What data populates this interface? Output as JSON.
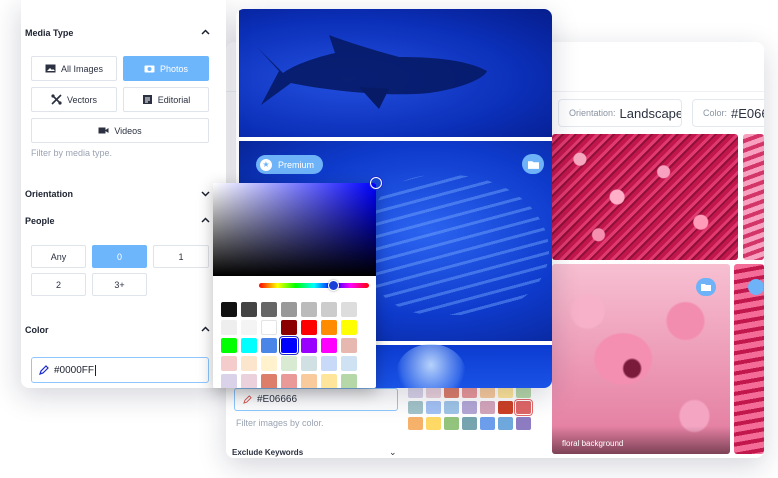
{
  "filters": {
    "media_type": {
      "title": "Media Type",
      "buttons": [
        {
          "label": "All Images",
          "active": false
        },
        {
          "label": "Photos",
          "active": true
        },
        {
          "label": "Vectors",
          "active": false
        },
        {
          "label": "Editorial",
          "active": false
        },
        {
          "label": "Videos",
          "active": false
        }
      ],
      "hint": "Filter by media type."
    },
    "orientation": {
      "title": "Orientation"
    },
    "people": {
      "title": "People",
      "options": [
        "Any",
        "0",
        "1",
        "2",
        "3+"
      ],
      "selected": "0"
    },
    "color": {
      "title": "Color",
      "value": "#0000FF"
    }
  },
  "picker": {
    "selected_color": "#0000FF",
    "swatches": [
      "#111111",
      "#444444",
      "#666666",
      "#999999",
      "#bbbbbb",
      "#cccccc",
      "#dddddd",
      "#eeeeee",
      "#f4f4f4",
      "#ffffff",
      "#8b0000",
      "#ff0000",
      "#ff8c00",
      "#ffff00",
      "#00ff00",
      "#00ffff",
      "#4a86e8",
      "#0000ff",
      "#9900ff",
      "#ff00ff",
      "#e6b8af",
      "#f4cccc",
      "#fce5cd",
      "#fff2cc",
      "#d9ead3",
      "#d0e0e3",
      "#c9daf8",
      "#cfe2f3",
      "#d9d2e9",
      "#ead1dc",
      "#dd7e6b",
      "#ea9999",
      "#f9cb9c",
      "#ffe599",
      "#b6d7a8"
    ]
  },
  "results_top": {
    "badge": "Premium"
  },
  "results_back": {
    "chips": [
      {
        "key": "Orientation:",
        "value": "Landscape"
      },
      {
        "key": "Color:",
        "value": "#E06666"
      }
    ],
    "color_value": "#E06666",
    "color_hint": "Filter images by color.",
    "exclude_title": "Exclude Keywords",
    "caption": "floral background",
    "swatches": [
      "#d9d2e9",
      "#ead1dc",
      "#dd7e6b",
      "#ea9999",
      "#f9cb9c",
      "#ffe599",
      "#b6d7a8",
      "#a2c4c9",
      "#a4c2f4",
      "#9fc5e8",
      "#b4a7d6",
      "#d5a6bd",
      "#cc4125",
      "#e06666",
      "#f6b26b",
      "#ffd966",
      "#93c47d",
      "#76a5af",
      "#6d9eeb",
      "#6fa8dc",
      "#8e7cc3"
    ],
    "selected_swatch": "#e06666"
  },
  "colors": {
    "accent": "#6eb6fb",
    "input_border": "#8ec7ff"
  }
}
